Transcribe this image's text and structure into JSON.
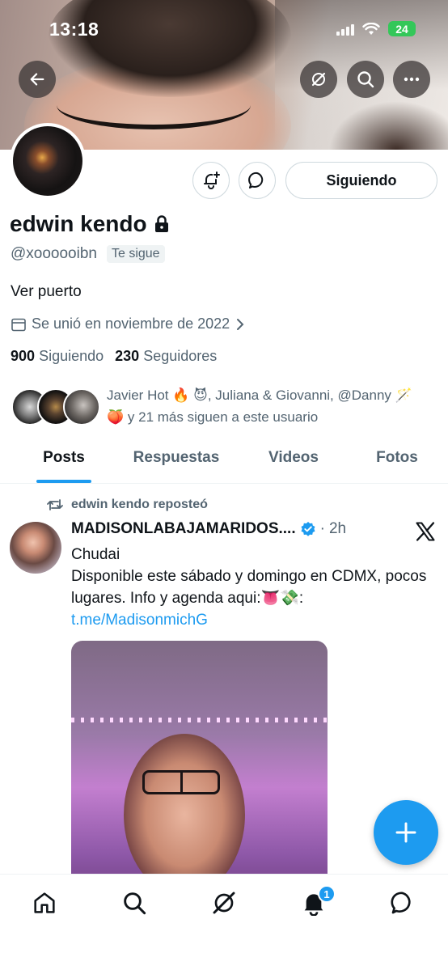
{
  "status_bar": {
    "time": "13:18",
    "battery": "24"
  },
  "profile": {
    "name": "edwin kendo",
    "handle": "@xoooooibn",
    "follows_you": "Te sigue",
    "bio": "Ver puerto",
    "joined": "Se unió en noviembre de 2022",
    "following_button": "Siguiendo",
    "following_count": "900",
    "following_label": "Siguiendo",
    "followers_count": "230",
    "followers_label": "Seguidores",
    "followers_known": "Javier Hot 🔥 😈, Juliana & Giovanni, @Danny 🪄 🍑 y 21 más siguen a este usuario"
  },
  "tabs": [
    {
      "label": "Posts",
      "active": true
    },
    {
      "label": "Respuestas"
    },
    {
      "label": "Videos"
    },
    {
      "label": "Fotos"
    }
  ],
  "post": {
    "repost_label": "edwin kendo reposteó",
    "author": "MADISONLABAJAMARIDOS....",
    "separator": "·",
    "time": "2h",
    "title": "Chudai",
    "body": "Disponible este sábado y domingo en CDMX, pocos lugares. Info y agenda aqui:👅💸: ",
    "link": "t.me/MadisonmichG"
  },
  "nav": {
    "notifications_badge": "1"
  },
  "colors": {
    "accent": "#1d9bf0",
    "text": "#0f1419",
    "muted": "#536471"
  }
}
